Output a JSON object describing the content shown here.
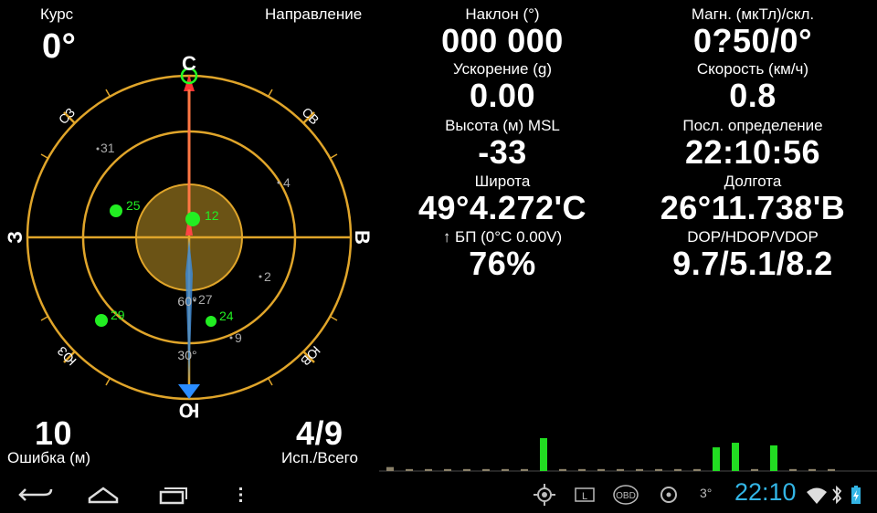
{
  "left": {
    "course_label": "Курс",
    "course_value": "0°",
    "direction_label": "Направление",
    "error_value": "10",
    "error_label": "Ошибка (м)",
    "sats_value": "4/9",
    "sats_label": "Исп./Всего"
  },
  "compass": {
    "cardinals": {
      "n": "С",
      "s": "Ю",
      "e": "В",
      "w": "З"
    },
    "intercardinals": {
      "nw": "СЗ",
      "ne": "СВ",
      "sw": "ЮЗ",
      "se": "ЮВ"
    },
    "elevation_labels": [
      "60°",
      "30°"
    ],
    "satellites": [
      {
        "id": "12",
        "used": true
      },
      {
        "id": "25",
        "used": true
      },
      {
        "id": "29",
        "used": true
      },
      {
        "id": "24",
        "used": true
      },
      {
        "id": "31",
        "used": false
      },
      {
        "id": "4",
        "used": false
      },
      {
        "id": "2",
        "used": false
      },
      {
        "id": "27",
        "used": false
      },
      {
        "id": "9",
        "used": false
      }
    ],
    "colors": {
      "ring": "#e0a52a",
      "used_sat": "#22ff22",
      "unused_sat": "#aaaaaa",
      "needle_north": "#ff3333",
      "needle_south": "#2a8cff"
    }
  },
  "stats": {
    "tilt_label": "Наклон (°)",
    "tilt_value": "000 000",
    "mag_label": "Магн. (мкТл)/скл.",
    "mag_value": "0?50/0°",
    "accel_label": "Ускорение (g)",
    "accel_value": "0.00",
    "speed_label": "Скорость (км/ч)",
    "speed_value": "0.8",
    "alt_label": "Высота (м) MSL",
    "alt_value": "-33",
    "last_fix_label": "Посл. определение",
    "last_fix_value": "22:10:56",
    "lat_label": "Широта",
    "lat_value": "49°4.272'С",
    "lon_label": "Долгота",
    "lon_value": "26°11.738'В",
    "battery_label": "↑ БП (0°С 0.00V)",
    "battery_value": "76%",
    "dop_label": "DOP/HDOP/VDOP",
    "dop_value": "9.7/5.1/8.2"
  },
  "signal_bars": {
    "values": [
      0.12,
      0.06,
      0.06,
      0.06,
      0.06,
      0.06,
      0.06,
      0.06,
      1.0,
      0.06,
      0.06,
      0.06,
      0.06,
      0.06,
      0.06,
      0.06,
      0.06,
      0.72,
      0.86,
      0.06,
      0.78,
      0.06,
      0.06,
      0.06
    ],
    "used_color": "#22dd22",
    "unused_color": "#8a8068"
  },
  "statusbar": {
    "time": "22:10",
    "temp": "3°",
    "obd_label": "OBD",
    "l_label": "L",
    "time_color": "#33b5e5"
  }
}
